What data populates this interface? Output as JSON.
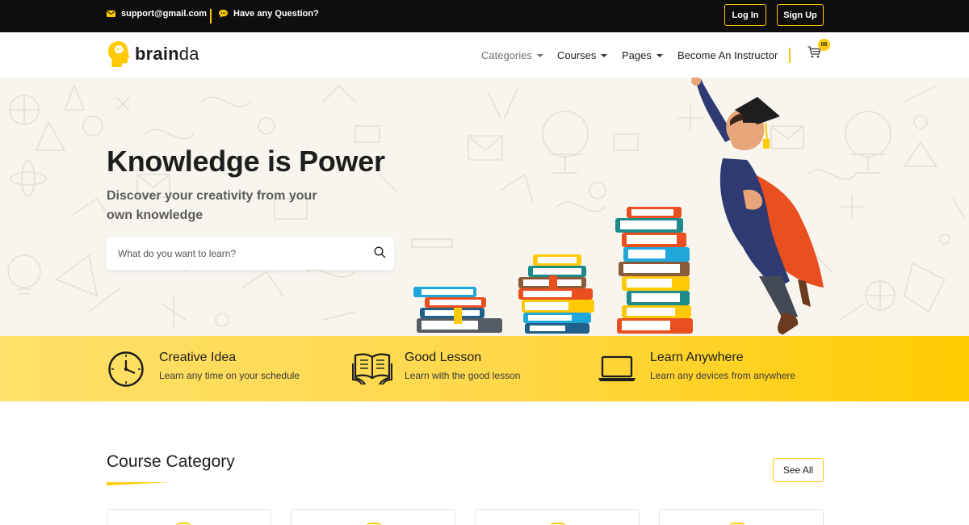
{
  "topbar": {
    "email": "support@gmail.com",
    "question": "Have any Question?",
    "login_label": "Log In",
    "signup_label": "Sign Up"
  },
  "nav": {
    "logo_bold": "brain",
    "logo_rest": "da",
    "items": [
      {
        "label": "Categories",
        "has_caret": true,
        "muted": true
      },
      {
        "label": "Courses",
        "has_caret": true
      },
      {
        "label": "Pages",
        "has_caret": true
      },
      {
        "label": "Become An Instructor",
        "has_caret": false
      }
    ],
    "cart_count": "06"
  },
  "hero": {
    "title": "Knowledge is Power",
    "subtitle": "Discover your creativity from your own knowledge",
    "search_placeholder": "What do you want to learn?"
  },
  "features": [
    {
      "icon": "clock-icon",
      "title": "Creative Idea",
      "desc": "Learn any time on your schedule"
    },
    {
      "icon": "open-book-icon",
      "title": "Good Lesson",
      "desc": "Learn with the good lesson"
    },
    {
      "icon": "laptop-icon",
      "title": "Learn Anywhere",
      "desc": "Learn any devices from anywhere"
    }
  ],
  "course_category": {
    "title": "Course Category",
    "see_all_label": "See All"
  },
  "colors": {
    "accent": "#ffc905",
    "topbar_bg": "#0e0e0e",
    "hero_bg": "#f7f5ee",
    "text_dark": "#1e1e1e"
  }
}
